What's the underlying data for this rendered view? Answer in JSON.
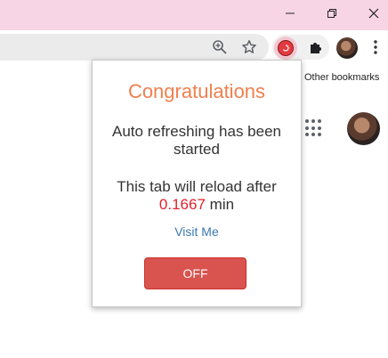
{
  "window_controls": {
    "minimize_icon": "minimize-icon",
    "restore_icon": "restore-icon",
    "close_icon": "close-icon"
  },
  "toolbar": {
    "zoom_icon": "zoom-icon",
    "bookmark_star_icon": "star-icon",
    "active_extension_icon": "auto-refresh-extension-icon",
    "extensions_icon": "puzzle-piece-icon",
    "menu_icon": "kebab-menu-icon"
  },
  "bookmarks_bar": {
    "other_bookmarks": "Other bookmarks"
  },
  "popup": {
    "title": "Congratulations",
    "message": "Auto refreshing has been started",
    "reload_prefix": "This tab will reload after",
    "reload_value": "0.1667",
    "reload_unit": "min",
    "visit_link": "Visit Me",
    "off_button": "OFF"
  },
  "colors": {
    "title_orange": "#f07f4e",
    "value_red": "#e0222a",
    "link_blue": "#3b78b2",
    "off_button_red": "#d9534f",
    "titlebar_pink": "#f7d5e5"
  }
}
